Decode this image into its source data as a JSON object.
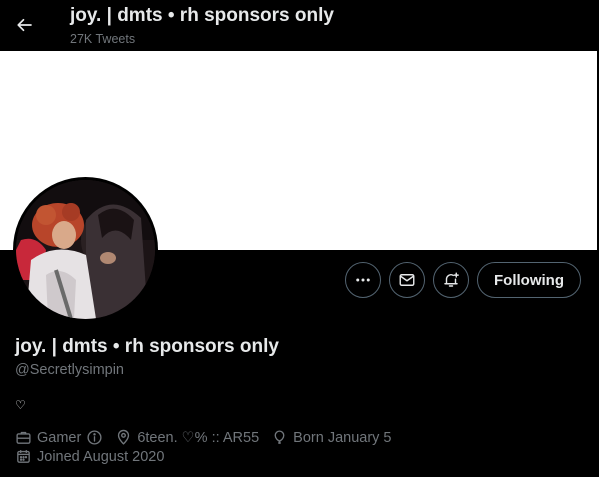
{
  "header": {
    "title": "joy. | dmts • rh sponsors only",
    "tweet_count": "27K Tweets"
  },
  "profile": {
    "display_name": "joy. | dmts • rh sponsors only",
    "handle": "@Secretlysimpin",
    "bio": "♡",
    "category": "Gamer",
    "location": "6teen. ♡% :: AR55",
    "birthday": "Born January 5",
    "joined": "Joined August 2020"
  },
  "actions": {
    "following_label": "Following"
  },
  "icons": {
    "back": "arrow-left-icon",
    "more": "more-horizontal-icon",
    "message": "envelope-icon",
    "notifications": "bell-plus-icon",
    "category": "briefcase-icon",
    "info": "info-circle-icon",
    "location": "location-pin-icon",
    "birthday": "balloon-icon",
    "joined": "calendar-icon"
  },
  "colors": {
    "background": "#000000",
    "banner": "#ffffff",
    "text_primary": "#e7e9ea",
    "text_secondary": "#71767b",
    "border": "#536471"
  }
}
